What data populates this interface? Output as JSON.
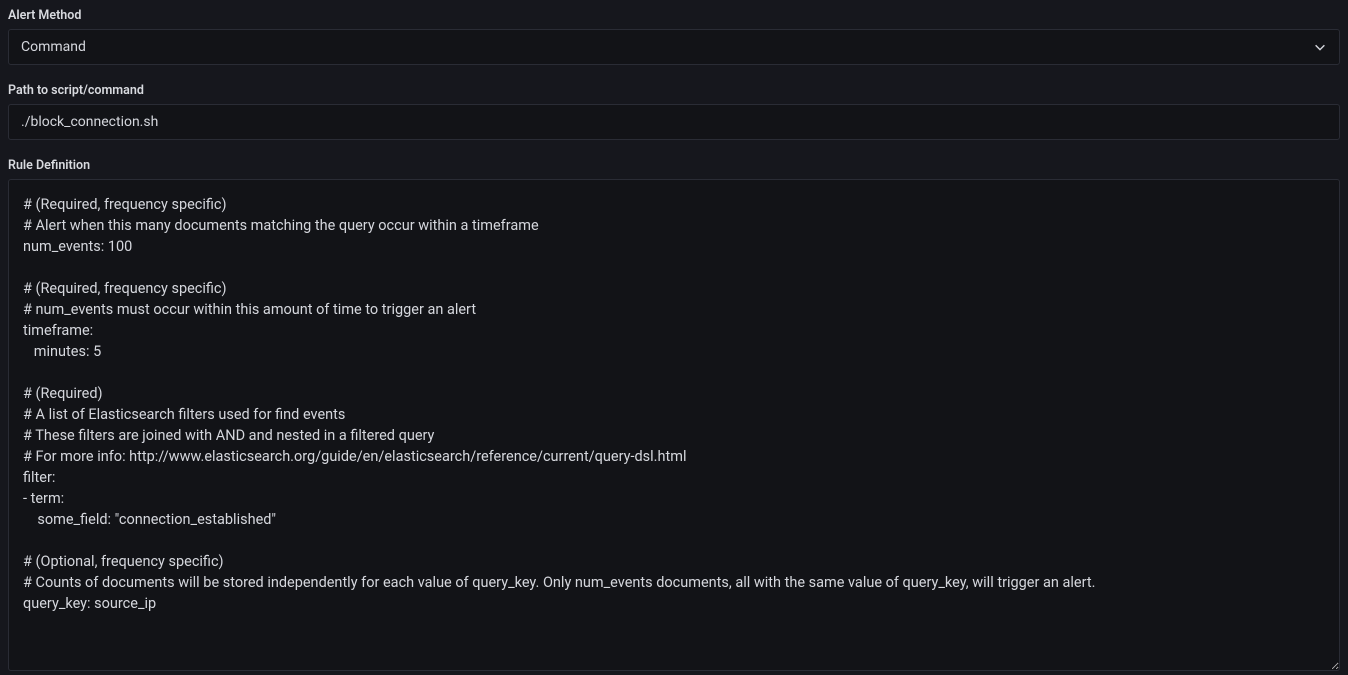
{
  "fields": {
    "alert_method": {
      "label": "Alert Method",
      "value": "Command"
    },
    "script_path": {
      "label": "Path to script/command",
      "value": "./block_connection.sh"
    },
    "rule_definition": {
      "label": "Rule Definition",
      "value": "# (Required, frequency specific)\n# Alert when this many documents matching the query occur within a timeframe\nnum_events: 100\n\n# (Required, frequency specific)\n# num_events must occur within this amount of time to trigger an alert\ntimeframe:\n   minutes: 5\n\n# (Required)\n# A list of Elasticsearch filters used for find events\n# These filters are joined with AND and nested in a filtered query\n# For more info: http://www.elasticsearch.org/guide/en/elasticsearch/reference/current/query-dsl.html\nfilter:\n- term:\n    some_field: \"connection_established\"\n\n# (Optional, frequency specific)\n# Counts of documents will be stored independently for each value of query_key. Only num_events documents, all with the same value of query_key, will trigger an alert.\nquery_key: source_ip\n"
    }
  }
}
